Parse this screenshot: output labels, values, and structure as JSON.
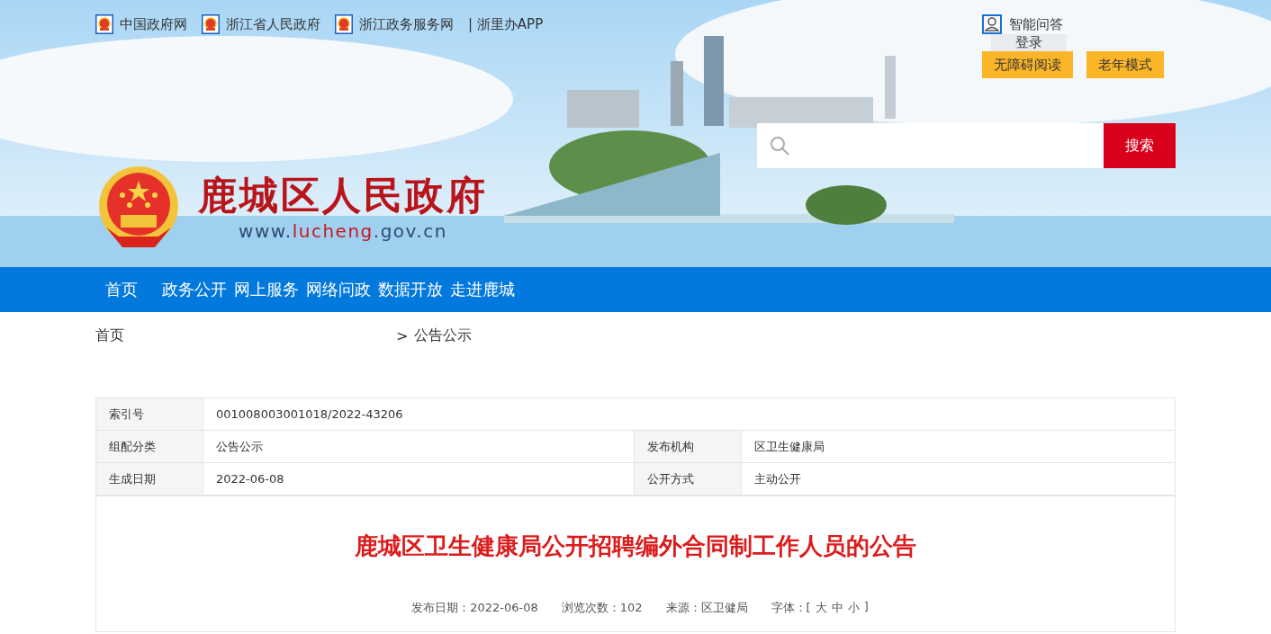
{
  "top_links": [
    {
      "label": "中国政府网",
      "icon": true
    },
    {
      "label": "浙江省人民政府",
      "icon": true
    },
    {
      "label": "浙江政务服务网",
      "icon": true
    },
    {
      "label": "| 浙里办APP",
      "icon": false
    }
  ],
  "tools": {
    "qa": "智能问答",
    "login": "登录",
    "buttons": [
      "无障碍阅读",
      "老年模式"
    ]
  },
  "banner": {
    "kind": "picture"
  },
  "site": {
    "title": "鹿城区人民政府",
    "url": [
      {
        "text": "www.",
        "highlight": false
      },
      {
        "text": "lucheng",
        "highlight": true
      },
      {
        "text": ".gov.cn",
        "highlight": false
      }
    ]
  },
  "search": {
    "button": "搜索"
  },
  "nav": [
    "首页",
    "政务公开",
    "网上服务",
    "网络问政",
    "数据开放",
    "走进鹿城"
  ],
  "breadcrumb": {
    "separator": ">",
    "items": [
      "首页",
      "公告公示"
    ]
  },
  "info_table": [
    [
      {
        "label": "索引号",
        "value": "001008003001018/2022-43206"
      }
    ],
    [
      {
        "label": "组配分类",
        "value": "公告公示"
      },
      {
        "label": "发布机构",
        "value": "区卫生健康局"
      }
    ],
    [
      {
        "label": "生成日期",
        "value": "2022-06-08"
      },
      {
        "label": "公开方式",
        "value": "主动公开"
      }
    ]
  ],
  "article": {
    "title": "鹿城区卫生健康局公开招聘编外合同制工作人员的公告",
    "meta": [
      {
        "label": "发布日期：",
        "value": "2022-06-08"
      },
      {
        "label": "浏览次数：",
        "value": "102"
      },
      {
        "label": "来源：",
        "value": "区卫健局"
      }
    ],
    "font_size": {
      "label": "字体：",
      "open": "[",
      "options": [
        "大",
        "中",
        "小"
      ],
      "close": "]"
    }
  }
}
